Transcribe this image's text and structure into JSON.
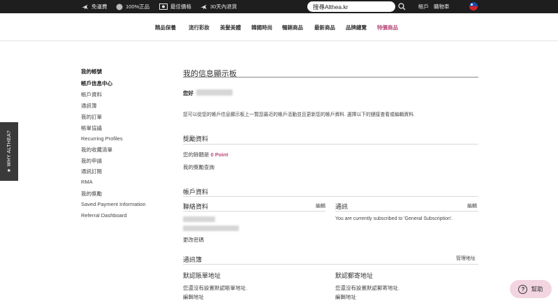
{
  "topbar": {
    "items": [
      {
        "icon": "airplane-icon",
        "label": "免運費"
      },
      {
        "icon": "authentic-icon",
        "label": "100%正品"
      },
      {
        "icon": "price-tag-icon",
        "label": "最佳價格"
      },
      {
        "icon": "airplane-icon",
        "label": "30天內退貨"
      }
    ],
    "search_value": "搜尋Althea.kr",
    "account_label": "帳戶",
    "cart_label": "購物車",
    "flag_icon": "taiwan-flag-icon"
  },
  "nav": {
    "items": [
      "精品保養",
      "流行彩妝",
      "美髮美體",
      "韓國時尚",
      "暢銷商品",
      "最新商品",
      "品牌總覽",
      "特價商品"
    ],
    "sale_color": "#b94a7a"
  },
  "side_tab": {
    "label": "★ WHY ALTHEA?"
  },
  "sidebar": {
    "title": "我的帳號",
    "items": [
      "帳戶信息中心",
      "帳戶資料",
      "通訊簿",
      "我的訂單",
      "帳單協議",
      "Recurring Profiles",
      "我的收藏清單",
      "我的申請",
      "通訊訂閱",
      "RMA",
      "我的獎勵",
      "Saved Payment Information",
      "Referral Dashboard"
    ]
  },
  "main": {
    "title": "我的信息顯示板",
    "greeting": "您好",
    "intro": "您可以從您的帳戶信息顯示板上一覽您最近的帳戶活動並且更新您的帳戶資料. 選擇以下的鏈接查看或編輯資料.",
    "rewards": {
      "heading": "獎勵資料",
      "balance_label": "您的餘額是",
      "balance_value": "0 Point",
      "history_link": "我的獎勵查詢"
    },
    "account": {
      "heading": "帳戶資料",
      "contact_heading": "聯絡資料",
      "contact_edit": "編輯",
      "change_password": "更改密碼",
      "newsletter_heading": "通訊",
      "newsletter_edit": "編輯",
      "newsletter_text": "You are currently subscribed to 'General Subscription'."
    },
    "address_book": {
      "heading": "通訊簿",
      "manage_link": "管理地址",
      "billing_heading": "默認賬單地址",
      "billing_text": "您還沒有設置默認賬單地址.",
      "billing_edit": "編輯地址",
      "shipping_heading": "默認郵寄地址",
      "shipping_text": "您還沒有設置默認郵寄地址.",
      "shipping_edit": "編輯地址"
    }
  },
  "help": {
    "label": "幫助",
    "icon": "question-icon"
  }
}
